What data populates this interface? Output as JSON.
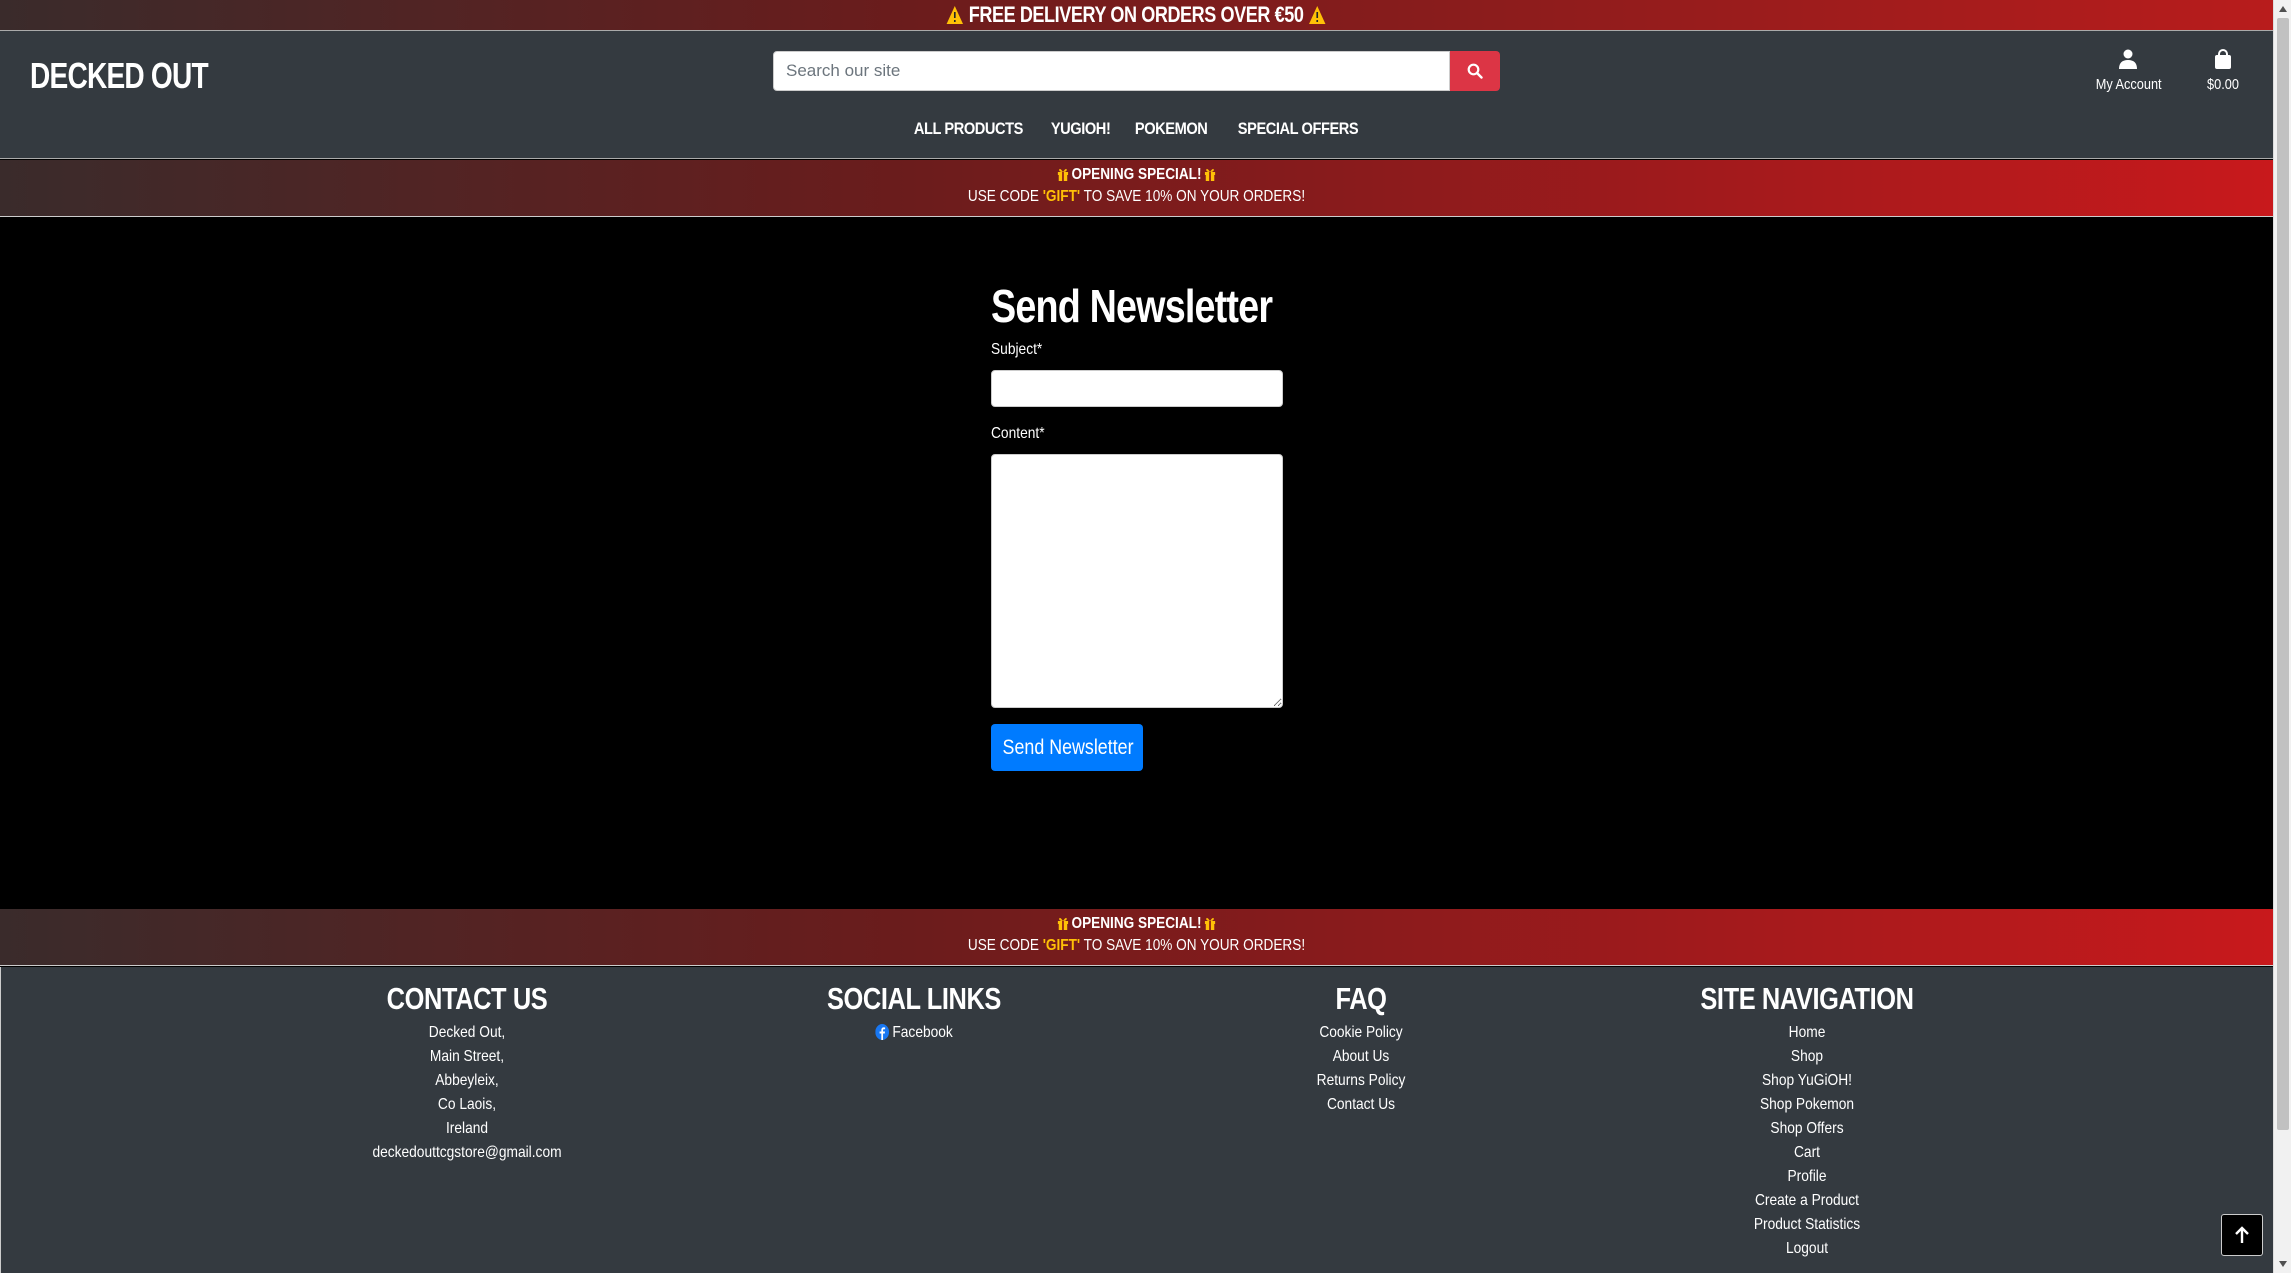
{
  "top_banner": {
    "text": "FREE DELIVERY ON ORDERS OVER €50"
  },
  "header": {
    "logo": "DECKED OUT",
    "search_placeholder": "Search our site",
    "account_label": "My Account",
    "cart_total": "$0.00",
    "nav": [
      "ALL PRODUCTS",
      "YUGIOH!",
      "POKEMON",
      "SPECIAL OFFERS"
    ]
  },
  "promo": {
    "title": "OPENING SPECIAL!",
    "line_prefix": "USE CODE ",
    "code": "'GIFT'",
    "line_suffix": " TO SAVE 10% ON YOUR ORDERS!"
  },
  "form": {
    "heading": "Send Newsletter",
    "subject_label": "Subject*",
    "content_label": "Content*",
    "submit_label": "Send Newsletter"
  },
  "footer": {
    "contact": {
      "heading": "CONTACT US",
      "lines": [
        "Decked Out,",
        "Main Street,",
        "Abbeyleix,",
        "Co Laois,",
        "Ireland",
        "deckedouttcgstore@gmail.com"
      ]
    },
    "social": {
      "heading": "SOCIAL LINKS",
      "links": [
        "Facebook"
      ]
    },
    "faq": {
      "heading": "FAQ",
      "links": [
        "Cookie Policy",
        "About Us",
        "Returns Policy",
        "Contact Us"
      ]
    },
    "site_nav": {
      "heading": "SITE NAVIGATION",
      "links": [
        "Home",
        "Shop",
        "Shop YuGiOH!",
        "Shop Pokemon",
        "Shop Offers",
        "Cart",
        "Profile",
        "Create a Product",
        "Product Statistics",
        "Logout"
      ]
    }
  },
  "colors": {
    "accent_red": "#dc3545",
    "primary_blue": "#007bff",
    "promo_code": "#ffc107",
    "header_bg": "#343a40",
    "warning": "#ffc107"
  },
  "icons": [
    "warning-icon",
    "search-icon",
    "user-icon",
    "shopping-bag-icon",
    "gift-icon",
    "facebook-icon",
    "arrow-up-icon"
  ]
}
